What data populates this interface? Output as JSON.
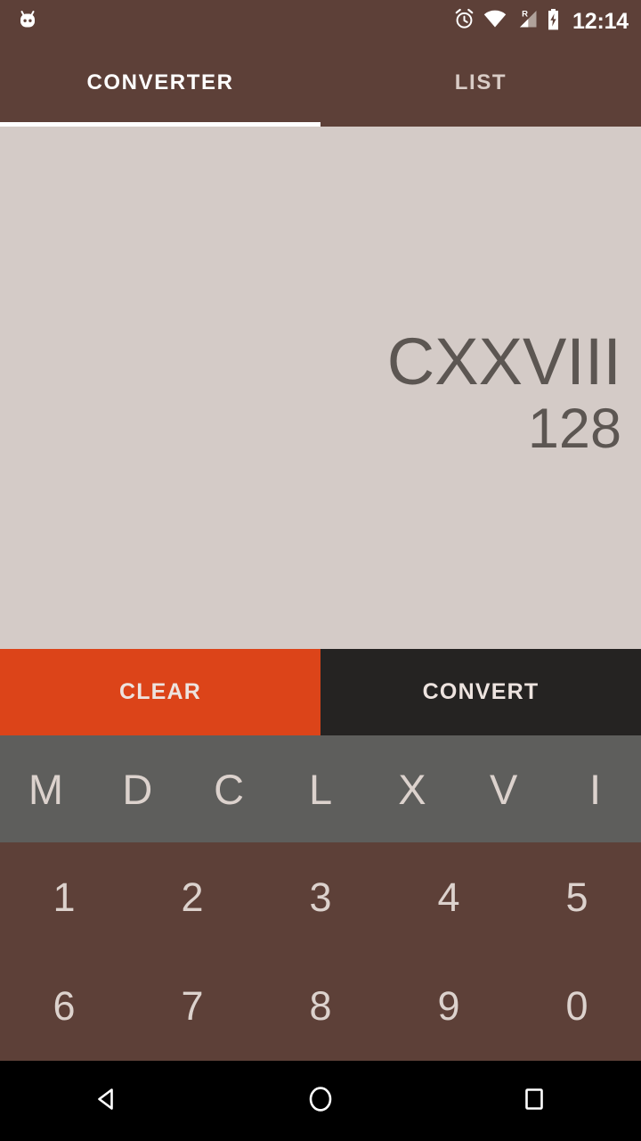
{
  "status_bar": {
    "notification_icon": "android-marshmallow-icon",
    "icons": [
      "alarm-icon",
      "wifi-icon",
      "signal-roaming-icon",
      "battery-charging-icon"
    ],
    "roaming_label": "R",
    "clock": "12:14"
  },
  "tabs": [
    {
      "label": "CONVERTER",
      "active": true
    },
    {
      "label": "LIST",
      "active": false
    }
  ],
  "display": {
    "roman": "CXXVIII",
    "arabic": "128"
  },
  "actions": {
    "clear_label": "CLEAR",
    "convert_label": "CONVERT"
  },
  "roman_keys": [
    "M",
    "D",
    "C",
    "L",
    "X",
    "V",
    "I"
  ],
  "digit_rows": [
    [
      "1",
      "2",
      "3",
      "4",
      "5"
    ],
    [
      "6",
      "7",
      "8",
      "9",
      "0"
    ]
  ],
  "nav_bar": {
    "back": "back-icon",
    "home": "home-icon",
    "recents": "recents-icon"
  },
  "colors": {
    "brand_brown": "#5D4038",
    "display_bg": "#D4CBC7",
    "display_text": "#5C5652",
    "accent_orange": "#DC4419",
    "convert_dark": "#252322",
    "roman_row_gray": "#5E5E5C",
    "key_text": "#DCD2CD"
  }
}
